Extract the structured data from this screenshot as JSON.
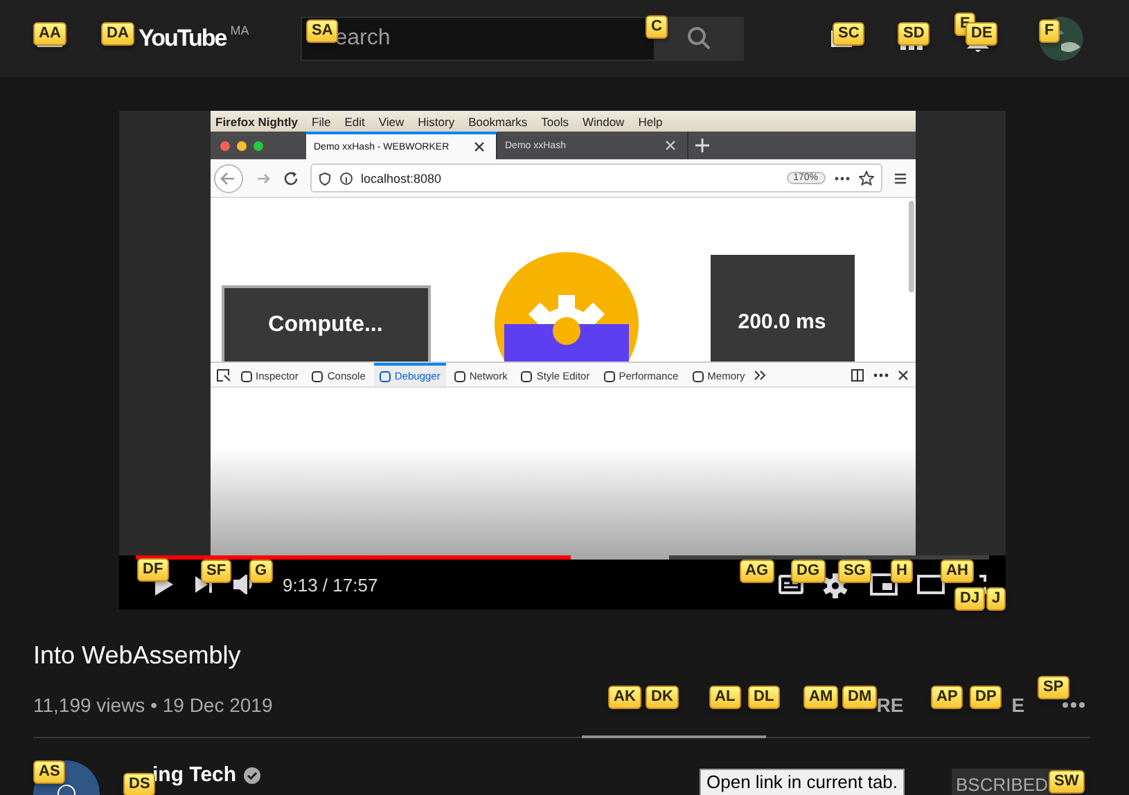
{
  "masthead": {
    "logo": "YouTube",
    "country": "MA",
    "search": {
      "placeholder": "earch"
    }
  },
  "player": {
    "frame": {
      "app": "Firefox Nightly",
      "menu": [
        "File",
        "Edit",
        "View",
        "History",
        "Bookmarks",
        "Tools",
        "Window",
        "Help"
      ],
      "tabs": [
        {
          "title": "Demo xxHash - WEBWORKER",
          "selected": true
        },
        {
          "title": "Demo xxHash",
          "selected": false
        }
      ],
      "url": "localhost:8080",
      "zoom": "170%",
      "page": {
        "button": "Compute...",
        "result": "200.0 ms"
      },
      "devtools_tabs": [
        {
          "label": "Inspector",
          "selected": false
        },
        {
          "label": "Console",
          "selected": false
        },
        {
          "label": "Debugger",
          "selected": true
        },
        {
          "label": "Network",
          "selected": false
        },
        {
          "label": "Style Editor",
          "selected": false
        },
        {
          "label": "Performance",
          "selected": false
        },
        {
          "label": "Memory",
          "selected": false
        }
      ]
    },
    "progress": {
      "level": 0.51
    },
    "buffered": {
      "level": 0.625
    },
    "time": "9:13 / 17:57"
  },
  "video": {
    "title": "Into WebAssembly",
    "meta": "11,199 views • 19 Dec 2019",
    "actions": [
      "RE",
      "E"
    ]
  },
  "channel": {
    "name": "ing Tech",
    "verified": true,
    "subscribe": "BSCRIBED"
  },
  "tooltip": "Open link in current tab.",
  "hints": [
    {
      "text": "AA"
    },
    {
      "text": "DA"
    },
    {
      "text": "SA"
    },
    {
      "text": "C"
    },
    {
      "text": "SC"
    },
    {
      "text": "SD"
    },
    {
      "text": "E"
    },
    {
      "text": "DE"
    },
    {
      "text": "F"
    },
    {
      "text": "DF"
    },
    {
      "text": "SF"
    },
    {
      "text": "G"
    },
    {
      "text": "AG"
    },
    {
      "text": "DG"
    },
    {
      "text": "SG"
    },
    {
      "text": "H"
    },
    {
      "text": "AH"
    },
    {
      "text": "DJ"
    },
    {
      "text": "J"
    },
    {
      "text": "AK"
    },
    {
      "text": "DK"
    },
    {
      "text": "AL"
    },
    {
      "text": "DL"
    },
    {
      "text": "AM"
    },
    {
      "text": "DM"
    },
    {
      "text": "AP"
    },
    {
      "text": "DP"
    },
    {
      "text": "SP"
    },
    {
      "text": "AS"
    },
    {
      "text": "DS"
    },
    {
      "text": "SW"
    }
  ]
}
